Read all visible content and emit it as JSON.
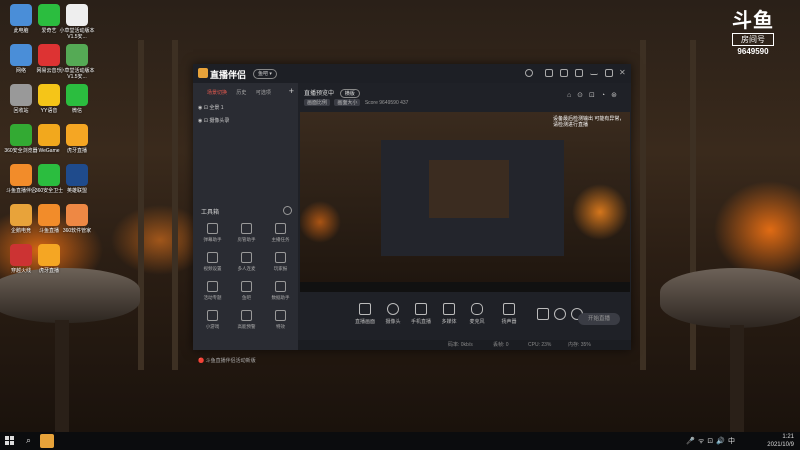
{
  "desktop": {
    "icons": [
      {
        "label": "此电脑",
        "color": "#4a8ed8"
      },
      {
        "label": "爱奇艺",
        "color": "#2bbd3f"
      },
      {
        "label": "小草堂活动版本V1.5安...",
        "color": "#eee"
      },
      {
        "label": "网络",
        "color": "#4a8ed8"
      },
      {
        "label": "网易云音乐",
        "color": "#d33"
      },
      {
        "label": "小草堂活动版本V1.5安...",
        "color": "#5a5"
      },
      {
        "label": "回收站",
        "color": "#999"
      },
      {
        "label": "YY语音",
        "color": "#f5c518"
      },
      {
        "label": "微信",
        "color": "#2bbd3f"
      },
      {
        "label": "360安全浏览器",
        "color": "#3a3"
      },
      {
        "label": "WeGame",
        "color": "#f2a81d"
      },
      {
        "label": "虎牙直播",
        "color": "#f5a623"
      },
      {
        "label": "斗鱼直播伴侣",
        "color": "#f28c2a"
      },
      {
        "label": "360安全卫士",
        "color": "#2bbd3f"
      },
      {
        "label": "英雄联盟",
        "color": "#1f4b8c"
      },
      {
        "label": "企鹅电竞",
        "color": "#e8a33a"
      },
      {
        "label": "斗鱼直播",
        "color": "#f28c2a"
      },
      {
        "label": "360软件管家",
        "color": "#e84"
      },
      {
        "label": "穿越火线",
        "color": "#c33"
      },
      {
        "label": "虎牙直播",
        "color": "#f5a623"
      }
    ]
  },
  "douyu": {
    "logo": "斗鱼",
    "room_label": "房间号",
    "room_number": "9649590"
  },
  "window": {
    "app_name": "直播伴侣",
    "version_badge": "鱼吧 ▾",
    "left_tabs": [
      "场景切换",
      "历史",
      "可选项"
    ],
    "plus": "+",
    "scenes": [
      {
        "name": "全景 1"
      },
      {
        "name": "摄像头录"
      }
    ],
    "tools_title": "工具箱",
    "tools": [
      {
        "label": "弹幕助手"
      },
      {
        "label": "房管助手"
      },
      {
        "label": "主播任务"
      },
      {
        "label": "视频设置"
      },
      {
        "label": "多人连麦"
      },
      {
        "label": "玩家报"
      },
      {
        "label": "活动专题"
      },
      {
        "label": "鱼吧"
      },
      {
        "label": "数据助手"
      },
      {
        "label": "小游戏"
      },
      {
        "label": "高能预警"
      },
      {
        "label": "特效"
      }
    ],
    "bottom_hint": "斗鱼直播伴侣活动新版",
    "main_title": "直播预览中",
    "main_tab": "横版",
    "sub_items": [
      "画面比例",
      "画面大小",
      "Score",
      "9649590",
      "437"
    ],
    "preview_note": "设备最后检测输出  可能有异常，请检测进行直播",
    "controls": [
      {
        "label": "直播画面"
      },
      {
        "label": "摄像头"
      },
      {
        "label": "手机直播"
      },
      {
        "label": "多媒体"
      },
      {
        "label": "麦克风"
      },
      {
        "label": "扬声器"
      }
    ],
    "go_live": "开始直播",
    "status_items": [
      "码率: 0kb/s",
      "丢帧: 0",
      "CPU: 23%",
      "内存: 35%"
    ]
  },
  "taskbar": {
    "time": "1:21",
    "date": "2021/10/9"
  }
}
